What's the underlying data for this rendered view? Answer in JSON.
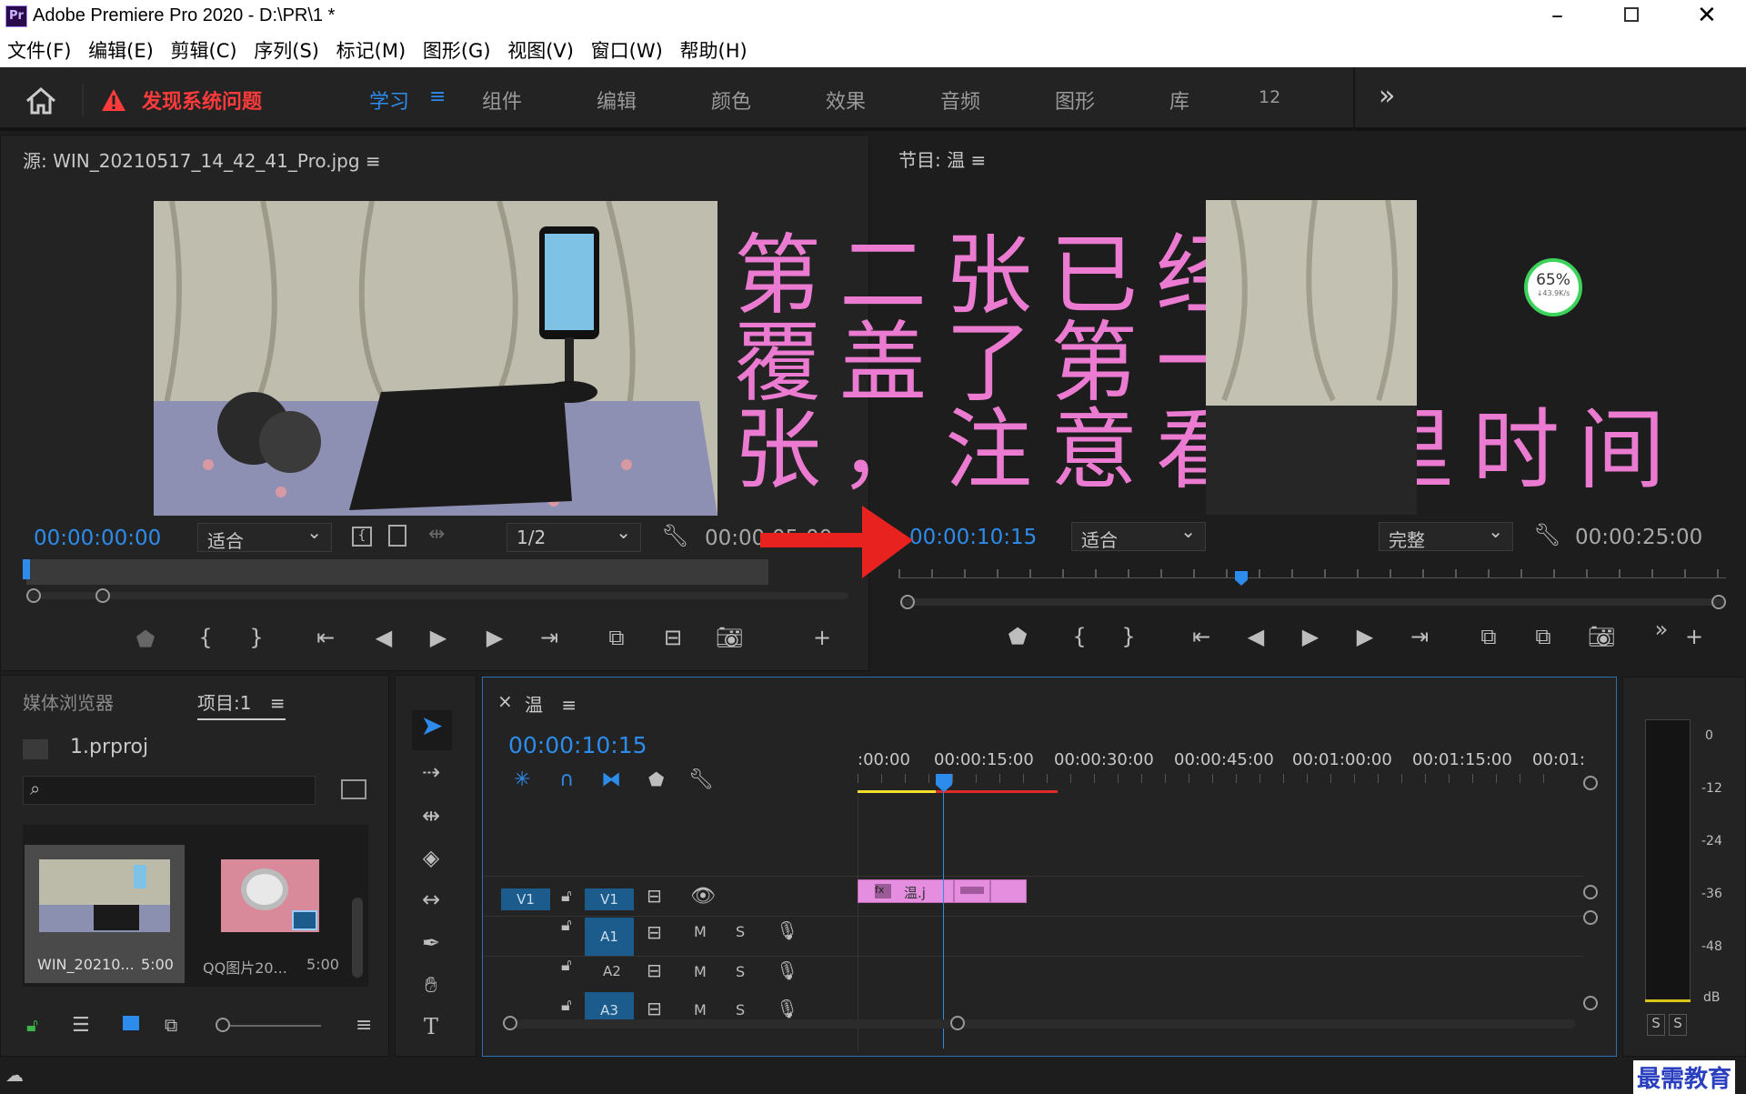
{
  "app": {
    "icon": "Pr",
    "title": "Adobe Premiere Pro 2020 - D:\\PR\\1 *"
  },
  "menu": [
    "文件(F)",
    "编辑(E)",
    "剪辑(C)",
    "序列(S)",
    "标记(M)",
    "图形(G)",
    "视图(V)",
    "窗口(W)",
    "帮助(H)"
  ],
  "workspace": {
    "alert": "发现系统问题",
    "tabs": [
      "学习",
      "组件",
      "编辑",
      "颜色",
      "效果",
      "音频",
      "图形",
      "库",
      "12"
    ],
    "more": "»"
  },
  "source": {
    "title": "源: WIN_20210517_14_42_41_Pro.jpg",
    "timecode": "00:00:00:00",
    "fit": "适合",
    "resolution": "1/2",
    "duration": "00:00:05:00"
  },
  "program": {
    "title": "节目: 温",
    "timecode": "00:00:10:15",
    "fit": "适合",
    "quality": "完整",
    "duration": "00:00:25:00"
  },
  "overlay": {
    "lines": [
      "第二张已经",
      "覆盖了第一",
      "张，注意看这里时间"
    ]
  },
  "network": {
    "percent": "65%",
    "speed": "↓43.9K/s"
  },
  "project": {
    "tabs": [
      "媒体浏览器",
      "项目:1"
    ],
    "file": "1.prproj",
    "items": [
      {
        "name": "WIN_20210...",
        "dur": "5:00"
      },
      {
        "name": "QQ图片20...",
        "dur": "5:00"
      }
    ]
  },
  "timeline": {
    "tab": "温",
    "timecode": "00:00:10:15",
    "ruler": [
      ":00:00",
      "00:00:15:00",
      "00:00:30:00",
      "00:00:45:00",
      "00:01:00:00",
      "00:01:15:00",
      "00:01:"
    ],
    "tracks": {
      "video": "V1",
      "audio": [
        "A1",
        "A2",
        "A3"
      ]
    },
    "clip_label": "温.j",
    "m": "M",
    "s": "S",
    "playhead_fraction": 0.11
  },
  "meter": {
    "labels": [
      "0",
      "-12",
      "-24",
      "-36",
      "-48",
      "dB"
    ],
    "solo": [
      "S",
      "S"
    ]
  },
  "watermark": "最需教育",
  "colors": {
    "accent": "#2d8ceb",
    "clip": "#e58ee0",
    "alert": "#ff3b3b",
    "overlay": "#ea7bd0",
    "arrow": "#e8231f"
  }
}
